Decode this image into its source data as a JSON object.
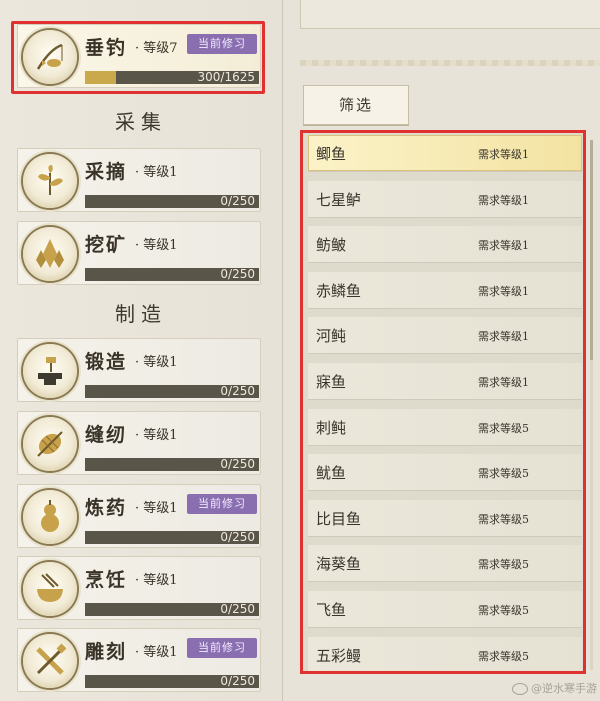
{
  "sections": {
    "gathering": "采集",
    "crafting": "制造"
  },
  "skills": [
    {
      "name": "垂钓",
      "level": "· 等级7",
      "badge": "当前修习",
      "progress": "300/1625",
      "fraction": 0.18,
      "active": true,
      "icon": "fishing-rod-icon"
    },
    {
      "name": "采摘",
      "level": "· 等级1",
      "badge": "",
      "progress": "0/250",
      "fraction": 0,
      "active": false,
      "icon": "herb-leaf-icon"
    },
    {
      "name": "挖矿",
      "level": "· 等级1",
      "badge": "",
      "progress": "0/250",
      "fraction": 0,
      "active": false,
      "icon": "ore-crystal-icon"
    },
    {
      "name": "锻造",
      "level": "· 等级1",
      "badge": "",
      "progress": "0/250",
      "fraction": 0,
      "active": false,
      "icon": "anvil-hammer-icon"
    },
    {
      "name": "缝纫",
      "level": "· 等级1",
      "badge": "",
      "progress": "0/250",
      "fraction": 0,
      "active": false,
      "icon": "thread-spool-icon"
    },
    {
      "name": "炼药",
      "level": "· 等级1",
      "badge": "当前修习",
      "progress": "0/250",
      "fraction": 0,
      "active": false,
      "icon": "gourd-icon"
    },
    {
      "name": "烹饪",
      "level": "· 等级1",
      "badge": "",
      "progress": "0/250",
      "fraction": 0,
      "active": false,
      "icon": "cooking-pot-icon"
    },
    {
      "name": "雕刻",
      "level": "· 等级1",
      "badge": "当前修习",
      "progress": "0/250",
      "fraction": 0,
      "active": false,
      "icon": "chisel-icon"
    }
  ],
  "filter": {
    "label": "筛选"
  },
  "fish": [
    {
      "name": "鲫鱼",
      "req": "需求等级1",
      "selected": true
    },
    {
      "name": "七星鲈",
      "req": "需求等级1",
      "selected": false
    },
    {
      "name": "鲂鲏",
      "req": "需求等级1",
      "selected": false
    },
    {
      "name": "赤鳞鱼",
      "req": "需求等级1",
      "selected": false
    },
    {
      "name": "河鲀",
      "req": "需求等级1",
      "selected": false
    },
    {
      "name": "寐鱼",
      "req": "需求等级1",
      "selected": false
    },
    {
      "name": "刺鲀",
      "req": "需求等级5",
      "selected": false
    },
    {
      "name": "鱿鱼",
      "req": "需求等级5",
      "selected": false
    },
    {
      "name": "比目鱼",
      "req": "需求等级5",
      "selected": false
    },
    {
      "name": "海葵鱼",
      "req": "需求等级5",
      "selected": false
    },
    {
      "name": "飞鱼",
      "req": "需求等级5",
      "selected": false
    },
    {
      "name": "五彩鳗",
      "req": "需求等级5",
      "selected": false
    }
  ],
  "colors": {
    "highlight": "#e03030",
    "badge": "#8a6fb0",
    "xp_fill": "#c9a94b"
  }
}
